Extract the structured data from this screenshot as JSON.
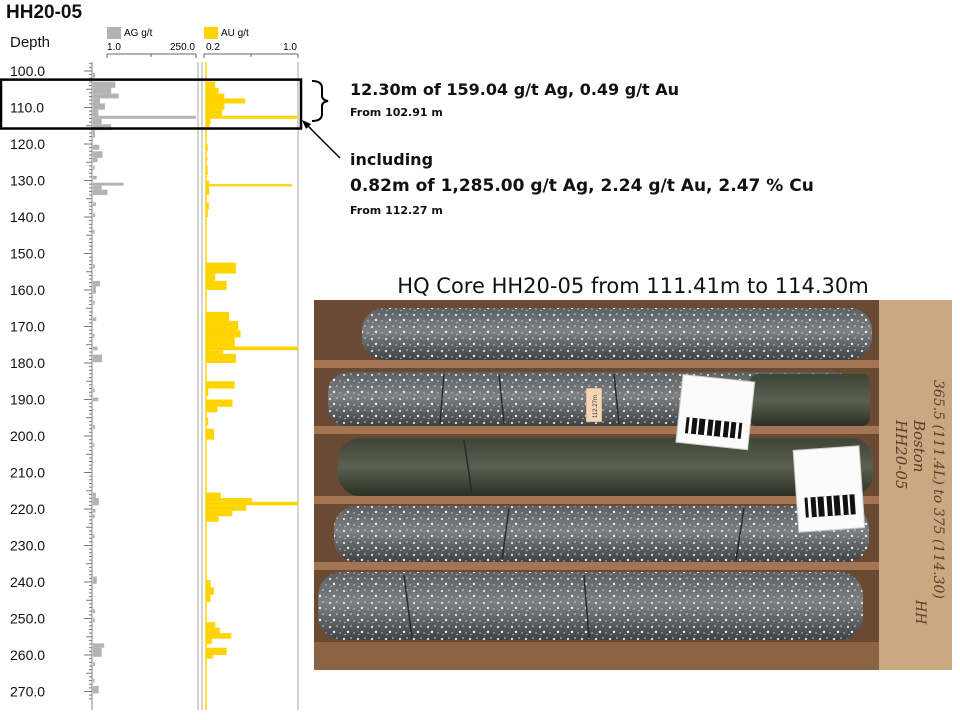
{
  "log": {
    "hole_id": "HH20-05",
    "depth_header": "Depth",
    "ag_legend": "AG g/t",
    "au_legend": "AU g/t",
    "ag_scale_min": "1.0",
    "ag_scale_max": "250.0",
    "au_scale_min": "0.2",
    "au_scale_max": "1.0",
    "ag_color": "#b3b3b3",
    "au_color": "#ffd400",
    "box_color": "#000000"
  },
  "annotations": {
    "interval_main": "12.30m of 159.04 g/t Ag, 0.49 g/t Au",
    "interval_from": "From 102.91 m",
    "including_label": "including",
    "including_main": "0.82m of 1,285.00 g/t Ag, 2.24 g/t Au, 2.47 % Cu",
    "including_from": "From 112.27 m"
  },
  "photo": {
    "caption": "HQ Core HH20-05 from 111.41m to 114.30m",
    "core_tag": "112.27m",
    "box_label_1": "Boston",
    "box_label_2": "HH20-05",
    "box_label_3": "365.5 (111.4L) to 375 (114.30)",
    "box_label_4": "HH"
  },
  "chart_data": [
    {
      "type": "bar",
      "orientation": "horizontal",
      "title": "AG g/t",
      "ylabel": "Depth",
      "ylim": [
        97.5,
        272
      ],
      "xlim": [
        1.0,
        250.0
      ],
      "depth_ticks": [
        100.0,
        110.0,
        120.0,
        130.0,
        140.0,
        150.0,
        160.0,
        170.0,
        180.0,
        190.0,
        200.0,
        210.0,
        220.0,
        230.0,
        240.0,
        250.0,
        260.0,
        270.0
      ],
      "depth_tick_labels": [
        "100.0",
        "110.0",
        "120.0",
        "130.0",
        "140.0",
        "150.0",
        "160.0",
        "170.0",
        "180.0",
        "190.0",
        "200.0",
        "210.0",
        "220.0",
        "230.0",
        "240.0",
        "250.0",
        "260.0",
        "270.0"
      ],
      "series": [
        {
          "name": "AG g/t",
          "intervals": [
            {
              "from": 100.5,
              "to": 101.8,
              "value": 6
            },
            {
              "from": 102.9,
              "to": 104.6,
              "value": 55
            },
            {
              "from": 104.6,
              "to": 106.2,
              "value": 45
            },
            {
              "from": 106.2,
              "to": 107.5,
              "value": 63
            },
            {
              "from": 107.5,
              "to": 108.9,
              "value": 18
            },
            {
              "from": 108.9,
              "to": 110.6,
              "value": 30
            },
            {
              "from": 110.6,
              "to": 112.3,
              "value": 14
            },
            {
              "from": 112.27,
              "to": 113.09,
              "value": 1285
            },
            {
              "from": 113.09,
              "to": 114.6,
              "value": 22
            },
            {
              "from": 114.6,
              "to": 116.2,
              "value": 45
            },
            {
              "from": 116.2,
              "to": 118.3,
              "value": 6
            },
            {
              "from": 120.2,
              "to": 121.6,
              "value": 16
            },
            {
              "from": 122.0,
              "to": 123.8,
              "value": 24
            },
            {
              "from": 123.8,
              "to": 125.0,
              "value": 12
            },
            {
              "from": 126.0,
              "to": 127.0,
              "value": 5
            },
            {
              "from": 128.7,
              "to": 129.7,
              "value": 10
            },
            {
              "from": 130.6,
              "to": 131.4,
              "value": 75
            },
            {
              "from": 131.4,
              "to": 132.5,
              "value": 22
            },
            {
              "from": 132.5,
              "to": 134.0,
              "value": 36
            },
            {
              "from": 136.0,
              "to": 137.0,
              "value": 8
            },
            {
              "from": 139.0,
              "to": 140.0,
              "value": 6
            },
            {
              "from": 143.5,
              "to": 144.5,
              "value": 5
            },
            {
              "from": 153.0,
              "to": 154.0,
              "value": 6
            },
            {
              "from": 157.5,
              "to": 159.0,
              "value": 18
            },
            {
              "from": 159.0,
              "to": 161.0,
              "value": 8
            },
            {
              "from": 163.0,
              "to": 164.0,
              "value": 5
            },
            {
              "from": 167.5,
              "to": 168.5,
              "value": 9
            },
            {
              "from": 172.0,
              "to": 173.0,
              "value": 5
            },
            {
              "from": 175.5,
              "to": 176.5,
              "value": 12
            },
            {
              "from": 177.7,
              "to": 179.8,
              "value": 23
            },
            {
              "from": 187.0,
              "to": 188.0,
              "value": 5
            },
            {
              "from": 189.5,
              "to": 190.5,
              "value": 14
            },
            {
              "from": 197.0,
              "to": 198.0,
              "value": 6
            },
            {
              "from": 202.0,
              "to": 203.0,
              "value": 4
            },
            {
              "from": 215.5,
              "to": 217.0,
              "value": 8
            },
            {
              "from": 217.0,
              "to": 219.0,
              "value": 15
            },
            {
              "from": 220.0,
              "to": 221.0,
              "value": 7
            },
            {
              "from": 221.5,
              "to": 222.5,
              "value": 5
            },
            {
              "from": 227.0,
              "to": 228.0,
              "value": 5
            },
            {
              "from": 238.5,
              "to": 240.5,
              "value": 10
            },
            {
              "from": 247.5,
              "to": 248.5,
              "value": 6
            },
            {
              "from": 250.0,
              "to": 251.0,
              "value": 5
            },
            {
              "from": 256.8,
              "to": 258.0,
              "value": 28
            },
            {
              "from": 258.0,
              "to": 260.5,
              "value": 22
            },
            {
              "from": 262.0,
              "to": 263.0,
              "value": 6
            },
            {
              "from": 266.5,
              "to": 267.5,
              "value": 5
            },
            {
              "from": 268.5,
              "to": 270.5,
              "value": 15
            }
          ]
        }
      ]
    },
    {
      "type": "bar",
      "orientation": "horizontal",
      "title": "AU g/t",
      "ylabel": "Depth",
      "ylim": [
        97.5,
        272
      ],
      "xlim": [
        0.2,
        1.0
      ],
      "series": [
        {
          "name": "AU g/t",
          "intervals": [
            {
              "from": 102.9,
              "to": 104.6,
              "value": 0.28
            },
            {
              "from": 104.6,
              "to": 106.2,
              "value": 0.31
            },
            {
              "from": 106.2,
              "to": 107.5,
              "value": 0.36
            },
            {
              "from": 107.5,
              "to": 108.9,
              "value": 0.54
            },
            {
              "from": 108.9,
              "to": 110.6,
              "value": 0.36
            },
            {
              "from": 110.6,
              "to": 112.3,
              "value": 0.34
            },
            {
              "from": 112.27,
              "to": 113.09,
              "value": 2.24
            },
            {
              "from": 113.09,
              "to": 114.6,
              "value": 0.24
            },
            {
              "from": 114.6,
              "to": 116.2,
              "value": 0.23
            },
            {
              "from": 120.0,
              "to": 122.0,
              "value": 0.215
            },
            {
              "from": 123.5,
              "to": 124.5,
              "value": 0.21
            },
            {
              "from": 126.0,
              "to": 128.5,
              "value": 0.215
            },
            {
              "from": 130.0,
              "to": 131.0,
              "value": 0.228
            },
            {
              "from": 131.0,
              "to": 131.6,
              "value": 0.95
            },
            {
              "from": 131.6,
              "to": 134.0,
              "value": 0.228
            },
            {
              "from": 136.0,
              "to": 138.0,
              "value": 0.225
            },
            {
              "from": 138.0,
              "to": 140.0,
              "value": 0.215
            },
            {
              "from": 152.5,
              "to": 155.5,
              "value": 0.46
            },
            {
              "from": 155.5,
              "to": 157.5,
              "value": 0.28
            },
            {
              "from": 157.5,
              "to": 160.0,
              "value": 0.38
            },
            {
              "from": 166.0,
              "to": 168.5,
              "value": 0.4
            },
            {
              "from": 168.5,
              "to": 171.0,
              "value": 0.48
            },
            {
              "from": 171.0,
              "to": 173.0,
              "value": 0.5
            },
            {
              "from": 173.0,
              "to": 175.5,
              "value": 0.45
            },
            {
              "from": 175.5,
              "to": 176.5,
              "value": 1.0
            },
            {
              "from": 176.5,
              "to": 177.5,
              "value": 0.35
            },
            {
              "from": 177.5,
              "to": 180.0,
              "value": 0.46
            },
            {
              "from": 185.0,
              "to": 187.0,
              "value": 0.45
            },
            {
              "from": 187.0,
              "to": 189.0,
              "value": 0.22
            },
            {
              "from": 190.0,
              "to": 192.0,
              "value": 0.43
            },
            {
              "from": 192.0,
              "to": 193.5,
              "value": 0.3
            },
            {
              "from": 195.0,
              "to": 197.0,
              "value": 0.22
            },
            {
              "from": 198.0,
              "to": 201.0,
              "value": 0.27
            },
            {
              "from": 215.5,
              "to": 217.0,
              "value": 0.33
            },
            {
              "from": 217.0,
              "to": 218.0,
              "value": 0.6
            },
            {
              "from": 218.0,
              "to": 219.0,
              "value": 1.0
            },
            {
              "from": 219.0,
              "to": 220.5,
              "value": 0.55
            },
            {
              "from": 220.5,
              "to": 222.0,
              "value": 0.43
            },
            {
              "from": 222.0,
              "to": 223.5,
              "value": 0.31
            },
            {
              "from": 239.5,
              "to": 241.5,
              "value": 0.24
            },
            {
              "from": 241.5,
              "to": 243.5,
              "value": 0.27
            },
            {
              "from": 243.5,
              "to": 245.5,
              "value": 0.24
            },
            {
              "from": 251.0,
              "to": 252.5,
              "value": 0.28
            },
            {
              "from": 252.5,
              "to": 254.0,
              "value": 0.32
            },
            {
              "from": 254.0,
              "to": 255.5,
              "value": 0.42
            },
            {
              "from": 255.5,
              "to": 257.0,
              "value": 0.25
            },
            {
              "from": 258.0,
              "to": 260.0,
              "value": 0.38
            },
            {
              "from": 260.0,
              "to": 261.0,
              "value": 0.26
            }
          ]
        }
      ]
    }
  ]
}
